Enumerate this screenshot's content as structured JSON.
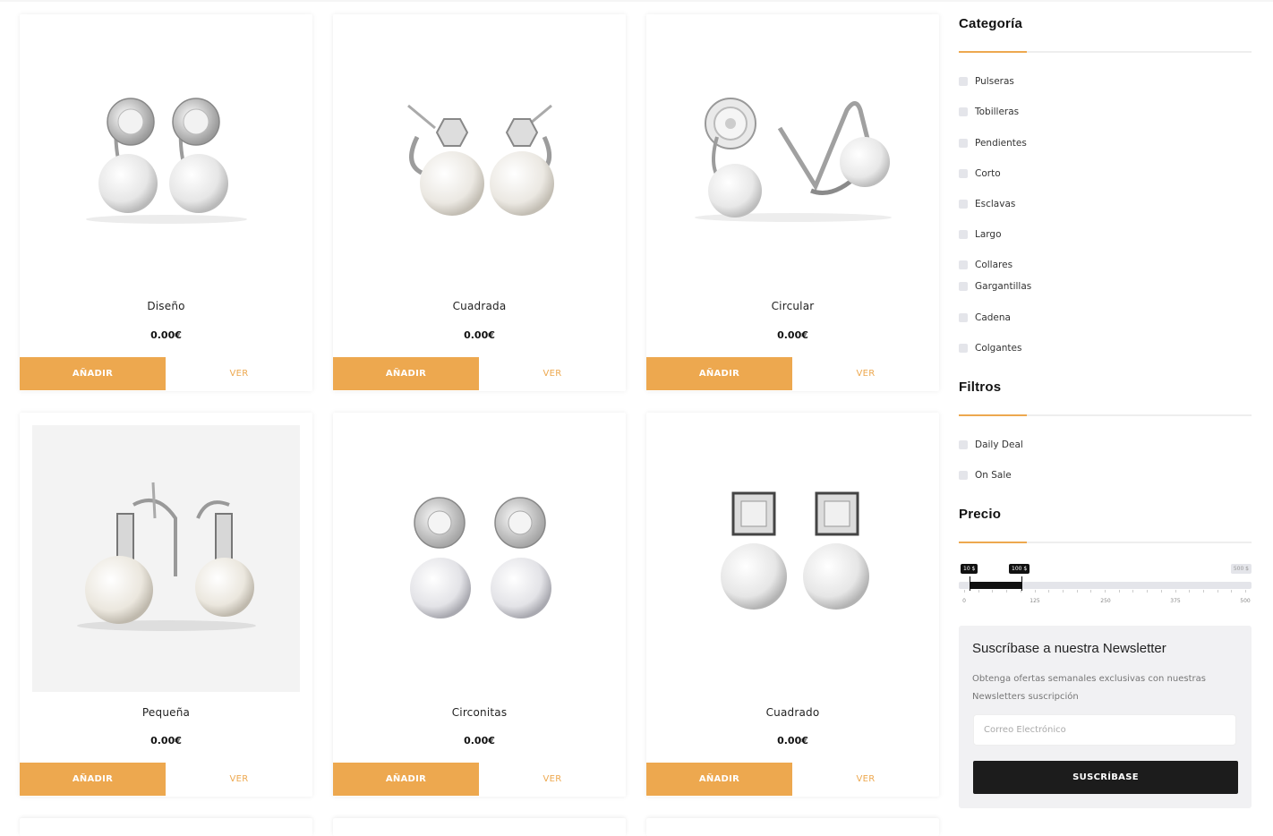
{
  "products": [
    {
      "name": "Diseño",
      "price": "0.00€",
      "add_label": "AÑADIR",
      "view_label": "VER"
    },
    {
      "name": "Cuadrada",
      "price": "0.00€",
      "add_label": "AÑADIR",
      "view_label": "VER"
    },
    {
      "name": "Circular",
      "price": "0.00€",
      "add_label": "AÑADIR",
      "view_label": "VER"
    },
    {
      "name": "Pequeña",
      "price": "0.00€",
      "add_label": "AÑADIR",
      "view_label": "VER"
    },
    {
      "name": "Circonitas",
      "price": "0.00€",
      "add_label": "AÑADIR",
      "view_label": "VER"
    },
    {
      "name": "Cuadrado",
      "price": "0.00€",
      "add_label": "AÑADIR",
      "view_label": "VER"
    }
  ],
  "sidebar": {
    "category": {
      "title": "Categoría",
      "items": [
        "Pulseras",
        "Tobilleras",
        "Pendientes",
        "Corto",
        "Esclavas",
        "Largo",
        "Collares",
        "Gargantillas",
        "Cadena",
        "Colgantes"
      ]
    },
    "filters": {
      "title": "Filtros",
      "items": [
        "Daily Deal",
        "On Sale"
      ]
    },
    "price": {
      "title": "Precio",
      "min_label": "10 $",
      "max_label": "100 $",
      "limit_label": "500 $",
      "selected_min": 10,
      "selected_max": 100,
      "range_max": 500,
      "ticks": [
        "0",
        "125",
        "250",
        "375",
        "500"
      ]
    },
    "newsletter": {
      "title": "Suscríbase a nuestra Newsletter",
      "text": "Obtenga ofertas semanales exclusivas con nuestras Newsletters suscripción",
      "email_placeholder": "Correo Electrónico",
      "button_label": "SUSCRÍBASE"
    }
  },
  "colors": {
    "accent": "#eda84f",
    "dark": "#1c1c1c",
    "checkbox": "#e4e5ea"
  },
  "icons": {
    "product_images": [
      "pearl-earrings-disc",
      "pearl-earrings-stud",
      "pearl-earrings-halo",
      "pearl-earrings-bar",
      "pearl-earrings-halo-round",
      "pearl-earrings-square"
    ]
  }
}
